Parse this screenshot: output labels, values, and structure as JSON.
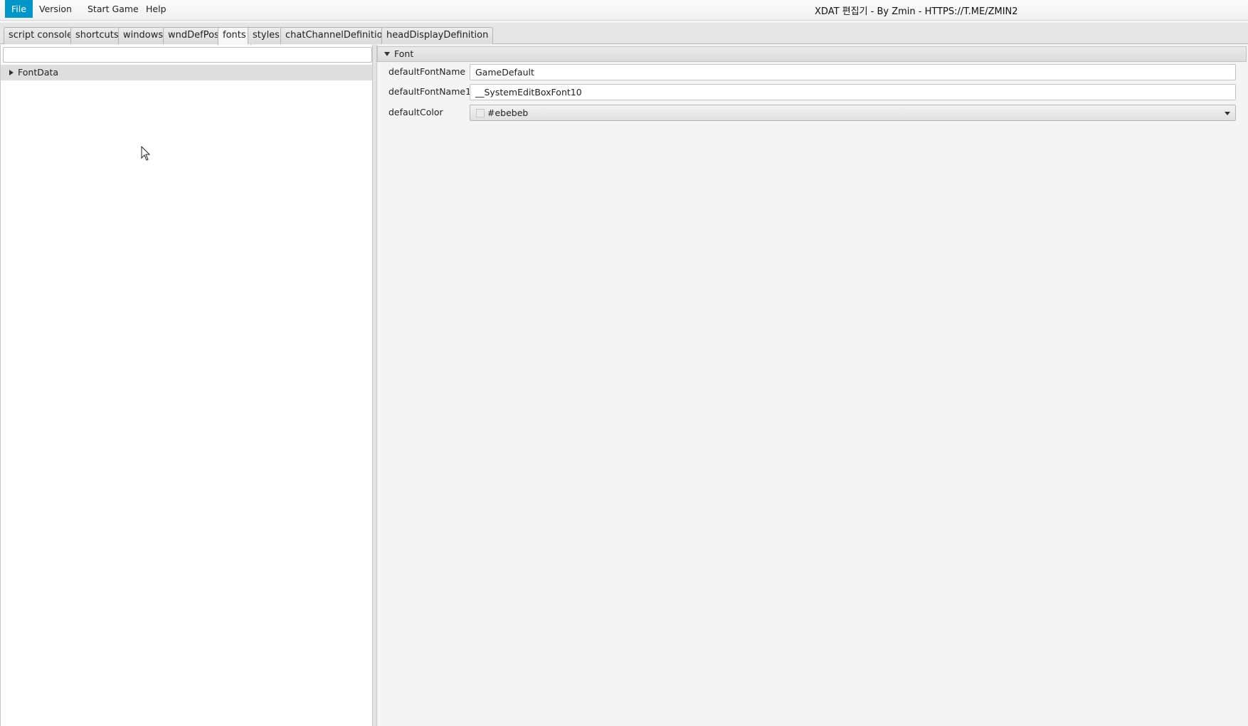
{
  "menu": {
    "items": [
      {
        "label": "File",
        "active": true
      },
      {
        "label": "Version"
      },
      {
        "label": "Start Game"
      },
      {
        "label": "Help"
      }
    ]
  },
  "window": {
    "title": "XDAT 편집기 -  By Zmin -  HTTPS://T.ME/ZMIN2"
  },
  "tabs": [
    {
      "label": "script console"
    },
    {
      "label": "shortcuts"
    },
    {
      "label": "windows"
    },
    {
      "label": "wndDefPos"
    },
    {
      "label": "fonts",
      "selected": true
    },
    {
      "label": "styles"
    },
    {
      "label": "chatChannelDefinition"
    },
    {
      "label": "headDisplayDefinition"
    }
  ],
  "left": {
    "search": {
      "value": "",
      "placeholder": ""
    },
    "tree": [
      {
        "label": "FontData",
        "expanded": false,
        "selected": true
      }
    ]
  },
  "right": {
    "section": {
      "label": "Font",
      "expanded": true
    },
    "properties": [
      {
        "label": "defaultFontName",
        "value": "GameDefault"
      },
      {
        "label": "defaultFontName1",
        "value": "__SystemEditBoxFont10"
      },
      {
        "label": "defaultColor",
        "value": "#ebebeb",
        "swatch": "#ebebeb"
      }
    ]
  },
  "colors": {
    "accent": "#0096c9",
    "tree_selection": "#dedede",
    "window_background": "#f4f4f4"
  },
  "icons": {
    "tree_toggle": "triangle-right-icon",
    "section_toggle": "triangle-down-icon",
    "combo": "chevron-down-icon",
    "pointer": "mouse-cursor-icon"
  }
}
